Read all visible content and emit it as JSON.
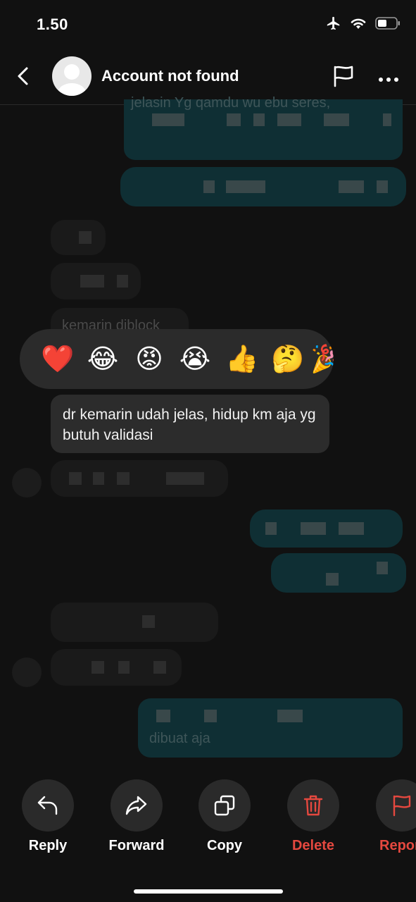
{
  "status_bar": {
    "time": "1.50"
  },
  "header": {
    "title": "Account not found"
  },
  "chat": {
    "ghost_top": "jelasin  Yg qamdu wu  ebu seres,",
    "ghost_in": "kemarin diblock",
    "ghost_bottom": "dibuat aja"
  },
  "reactions": [
    "❤️",
    "😂",
    "😡",
    "😭",
    "👍",
    "🤔",
    "🎉"
  ],
  "focused_message": {
    "text": "dr kemarin udah jelas, hidup km aja yg butuh validasi"
  },
  "actions": {
    "reply": "Reply",
    "forward": "Forward",
    "copy": "Copy",
    "delete": "Delete",
    "report": "Report"
  },
  "colors": {
    "destructive": "#e5483f",
    "outgoing_bubble": "#0f2f34",
    "background": "#111111"
  }
}
